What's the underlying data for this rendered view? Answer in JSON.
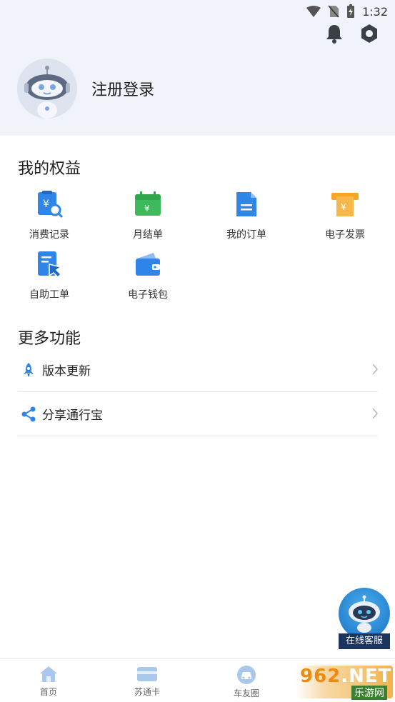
{
  "status_bar": {
    "time": "1:32"
  },
  "profile": {
    "login_label": "注册登录"
  },
  "benefits": {
    "title": "我的权益",
    "items": [
      {
        "label": "消费记录",
        "icon": "receipt-search-icon",
        "color": "#2f86e8"
      },
      {
        "label": "月结单",
        "icon": "calendar-yen-icon",
        "color": "#3dbb5c"
      },
      {
        "label": "我的订单",
        "icon": "document-icon",
        "color": "#2f86e8"
      },
      {
        "label": "电子发票",
        "icon": "invoice-yen-icon",
        "color": "#f5a623"
      },
      {
        "label": "自助工单",
        "icon": "self-service-ticket-icon",
        "color": "#2f86e8"
      },
      {
        "label": "电子钱包",
        "icon": "wallet-icon",
        "color": "#2f86e8"
      }
    ]
  },
  "more_functions": {
    "title": "更多功能",
    "items": [
      {
        "label": "版本更新",
        "icon": "rocket-icon"
      },
      {
        "label": "分享通行宝",
        "icon": "share-icon"
      }
    ]
  },
  "service_fab": {
    "label": "在线客服"
  },
  "bottom_nav": {
    "items": [
      {
        "label": "首页",
        "icon": "home-icon"
      },
      {
        "label": "苏通卡",
        "icon": "card-icon"
      },
      {
        "label": "车友圈",
        "icon": "car-circle-icon"
      }
    ]
  },
  "watermark": {
    "top": "962",
    "suffix": ".NET",
    "bottom": "乐游网"
  },
  "colors": {
    "accent": "#2f86e8",
    "header_bg": "#f1f3fb"
  }
}
